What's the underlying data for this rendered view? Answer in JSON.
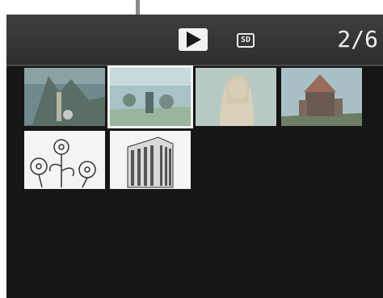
{
  "viewer": {
    "mode_icon": "play-icon",
    "media_icon": "sd-card-icon",
    "media_label": "SD",
    "counter": "2/6",
    "selected_index": 2
  },
  "thumbnails": [
    {
      "icon": "landscape-photo-icon",
      "selected": false
    },
    {
      "icon": "beach-scene-photo-icon",
      "selected": true
    },
    {
      "icon": "portrait-woman-photo-icon",
      "selected": false
    },
    {
      "icon": "castle-photo-icon",
      "selected": false
    },
    {
      "icon": "flowers-drawing-icon",
      "selected": false
    },
    {
      "icon": "building-drawing-icon",
      "selected": false
    }
  ]
}
